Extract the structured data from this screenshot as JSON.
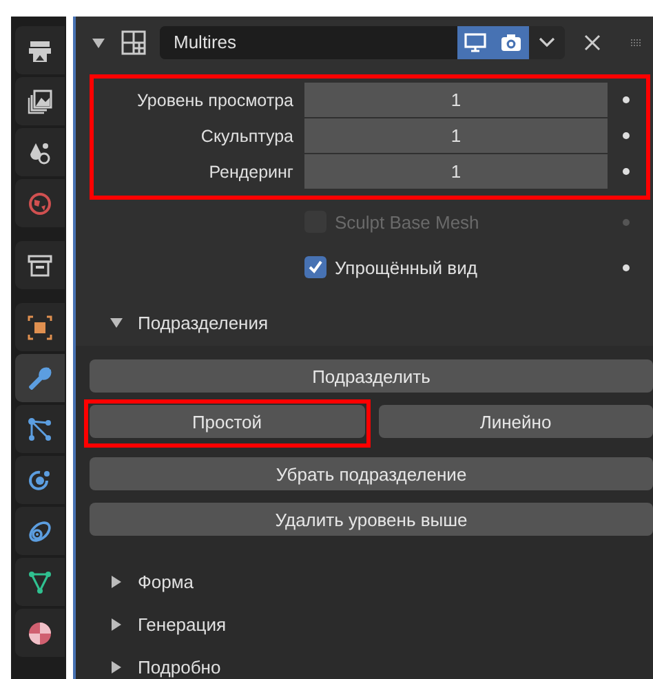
{
  "sidebar": {
    "tabs": [
      {
        "kind": "render",
        "selected": false
      },
      {
        "kind": "output",
        "selected": false
      },
      {
        "kind": "view_layer",
        "selected": false
      },
      {
        "kind": "scene",
        "selected": false
      },
      {
        "kind": "collection",
        "selected": false
      },
      {
        "kind": "object",
        "selected": false
      },
      {
        "kind": "modifiers",
        "selected": true
      },
      {
        "kind": "particles",
        "selected": false
      },
      {
        "kind": "physics",
        "selected": false
      },
      {
        "kind": "constraints",
        "selected": false
      },
      {
        "kind": "data",
        "selected": false
      },
      {
        "kind": "material",
        "selected": false
      }
    ]
  },
  "modifier": {
    "name": "Multires",
    "expanded": true,
    "show_viewport": true,
    "show_render": true
  },
  "levels": {
    "highlighted": true,
    "fields": [
      {
        "label": "Уровень просмотра",
        "value": "1"
      },
      {
        "label": "Скульптура",
        "value": "1"
      },
      {
        "label": "Рендеринг",
        "value": "1"
      }
    ]
  },
  "checkboxes": [
    {
      "label": "Sculpt Base Mesh",
      "checked": false,
      "disabled": true
    },
    {
      "label": "Упрощённый вид",
      "checked": true,
      "disabled": false
    }
  ],
  "subdivisions": {
    "title": "Подразделения",
    "expanded": true,
    "button_groups": [
      [
        [
          {
            "label": "Подразделить",
            "highlighted": false
          }
        ],
        [
          {
            "label": "Простой",
            "highlighted": true
          },
          {
            "label": "Линейно",
            "highlighted": false
          }
        ]
      ],
      [
        [
          {
            "label": "Убрать подразделение",
            "highlighted": false
          }
        ],
        [
          {
            "label": "Удалить уровень выше",
            "highlighted": false
          }
        ]
      ]
    ]
  },
  "panels": [
    {
      "title": "Форма",
      "expanded": false
    },
    {
      "title": "Генерация",
      "expanded": false
    },
    {
      "title": "Подробно",
      "expanded": false
    }
  ]
}
